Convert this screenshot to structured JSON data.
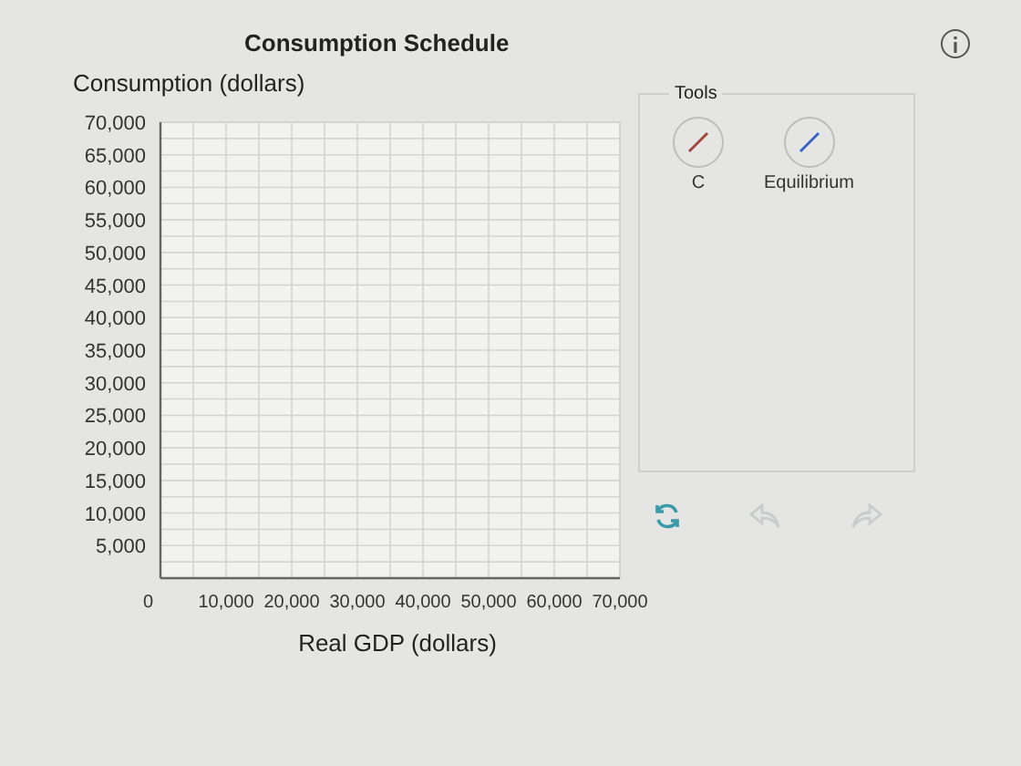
{
  "title": "Consumption Schedule",
  "chart": {
    "chart_data": {
      "type": "line",
      "grid": true,
      "ylabel": "Consumption (dollars)",
      "xlabel": "Real GDP (dollars)",
      "xlim": [
        0,
        70000
      ],
      "ylim": [
        0,
        70000
      ],
      "xticks": [
        {
          "value": 0,
          "label": "0"
        },
        {
          "value": 10000,
          "label": "10,000"
        },
        {
          "value": 20000,
          "label": "20,000"
        },
        {
          "value": 30000,
          "label": "30,000"
        },
        {
          "value": 40000,
          "label": "40,000"
        },
        {
          "value": 50000,
          "label": "50,000"
        },
        {
          "value": 60000,
          "label": "60,000"
        },
        {
          "value": 70000,
          "label": "70,000"
        }
      ],
      "yticks": [
        {
          "value": 5000,
          "label": "5,000"
        },
        {
          "value": 10000,
          "label": "10,000"
        },
        {
          "value": 15000,
          "label": "15,000"
        },
        {
          "value": 20000,
          "label": "20,000"
        },
        {
          "value": 25000,
          "label": "25,000"
        },
        {
          "value": 30000,
          "label": "30,000"
        },
        {
          "value": 35000,
          "label": "35,000"
        },
        {
          "value": 40000,
          "label": "40,000"
        },
        {
          "value": 45000,
          "label": "45,000"
        },
        {
          "value": 50000,
          "label": "50,000"
        },
        {
          "value": 55000,
          "label": "55,000"
        },
        {
          "value": 60000,
          "label": "60,000"
        },
        {
          "value": 65000,
          "label": "65,000"
        },
        {
          "value": 70000,
          "label": "70,000"
        }
      ]
    }
  },
  "tools": {
    "title": "Tools",
    "items": [
      {
        "label": "C",
        "color": "#a0463a"
      },
      {
        "label": "Equilibrium",
        "color": "#3a66c8"
      }
    ]
  },
  "actions": [
    {
      "kind": "reset",
      "disabled": false
    },
    {
      "kind": "undo",
      "disabled": true
    },
    {
      "kind": "redo",
      "disabled": true
    }
  ]
}
